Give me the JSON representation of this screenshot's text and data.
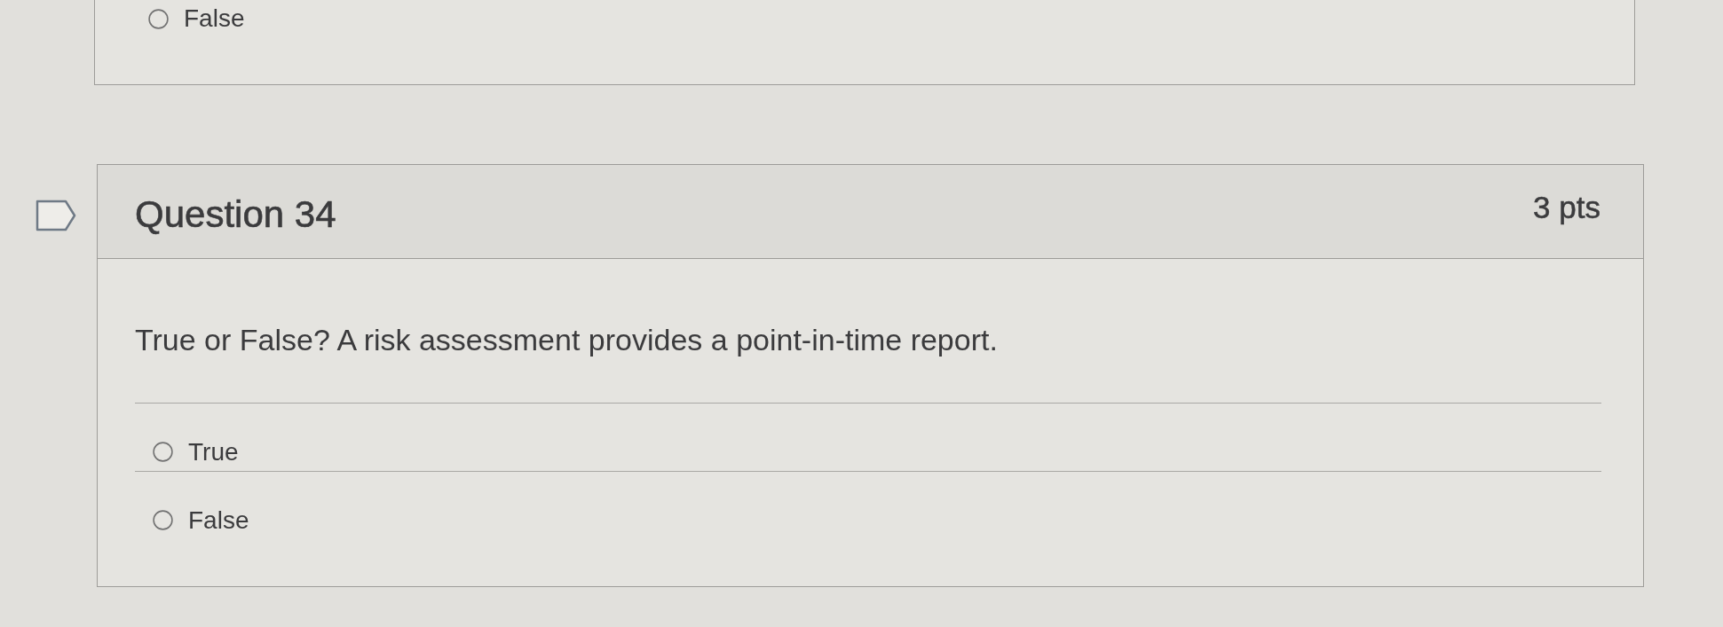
{
  "previous_question": {
    "answers": [
      {
        "label": "False",
        "selected": false
      }
    ]
  },
  "question": {
    "title": "Question 34",
    "points": "3 pts",
    "flagged": false,
    "text": "True or False? A risk assessment provides a point-in-time report.",
    "answers": [
      {
        "label": "True",
        "selected": false
      },
      {
        "label": "False",
        "selected": false
      }
    ]
  }
}
